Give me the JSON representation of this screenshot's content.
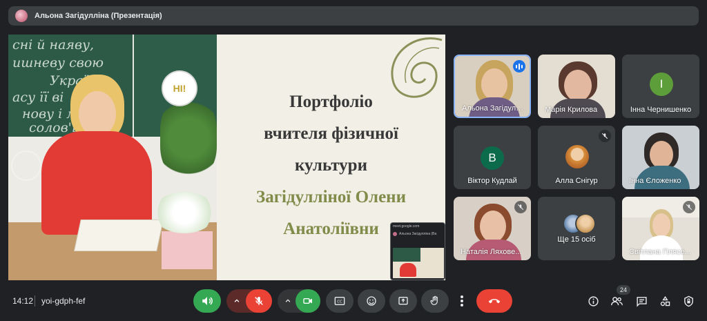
{
  "topbar": {
    "title": "Альона Загідулліна (Презентація)"
  },
  "slide": {
    "chalk_lines": [
      "сні й наяву,",
      "ишневу свою",
      "Украї",
      "асу її ві",
      "нову і мо",
      "солов'ї"
    ],
    "hi_badge": "HI!",
    "lines": [
      "Портфоліо",
      "вчителя фізичної",
      "культури",
      "Загідулліної Олени",
      "Анатоліївни"
    ],
    "mini_pip": {
      "url": "meet.google.com",
      "presenter": "Альона Загідулліна (Ва"
    }
  },
  "participants": [
    {
      "name": "Альона Загідулліна",
      "display": "Альона Загідулл...",
      "speaking": true,
      "muted": false
    },
    {
      "name": "Марія Крилова",
      "display": "Марія Крилова",
      "muted": false
    },
    {
      "name": "Інна Чернишенко",
      "display": "Інна Чернишенко",
      "letter": "І",
      "color": "#5e9e3a",
      "muted": false
    },
    {
      "name": "Віктор Кудлай",
      "display": "Віктор Кудлай",
      "letter": "В",
      "color": "#0b6b4b",
      "muted": false
    },
    {
      "name": "Алла Снігур",
      "display": "Алла Снігур",
      "muted": true
    },
    {
      "name": "Інна Єложенко",
      "display": "Інна Єложенко",
      "muted": false
    },
    {
      "name": "Наталія Ляхова",
      "display": "Наталія Ляхове...",
      "muted": true
    },
    {
      "name": "others",
      "display": "Ще 15 осіб",
      "muted": false
    },
    {
      "name": "Світлана Плясе",
      "display": "Світлана Плясе...",
      "muted": true
    }
  ],
  "bottombar": {
    "time": "14:12",
    "meeting_code": "yoi-gdph-fef",
    "participant_count": "24"
  },
  "colors": {
    "background": "#202124",
    "tile": "#3c4043",
    "accent_green": "#34a853",
    "accent_red": "#ea4335",
    "speaking_blue": "#8ab4f8",
    "slide_title": "#383838",
    "slide_name": "#818b4a"
  },
  "icons": [
    "mic-icon",
    "chevron-up-icon",
    "mic-off-icon",
    "camera-icon",
    "captions-icon",
    "emoji-icon",
    "present-icon",
    "raise-hand-icon",
    "more-vert-icon",
    "call-end-icon",
    "info-icon",
    "people-icon",
    "chat-icon",
    "activities-icon",
    "host-controls-icon"
  ]
}
